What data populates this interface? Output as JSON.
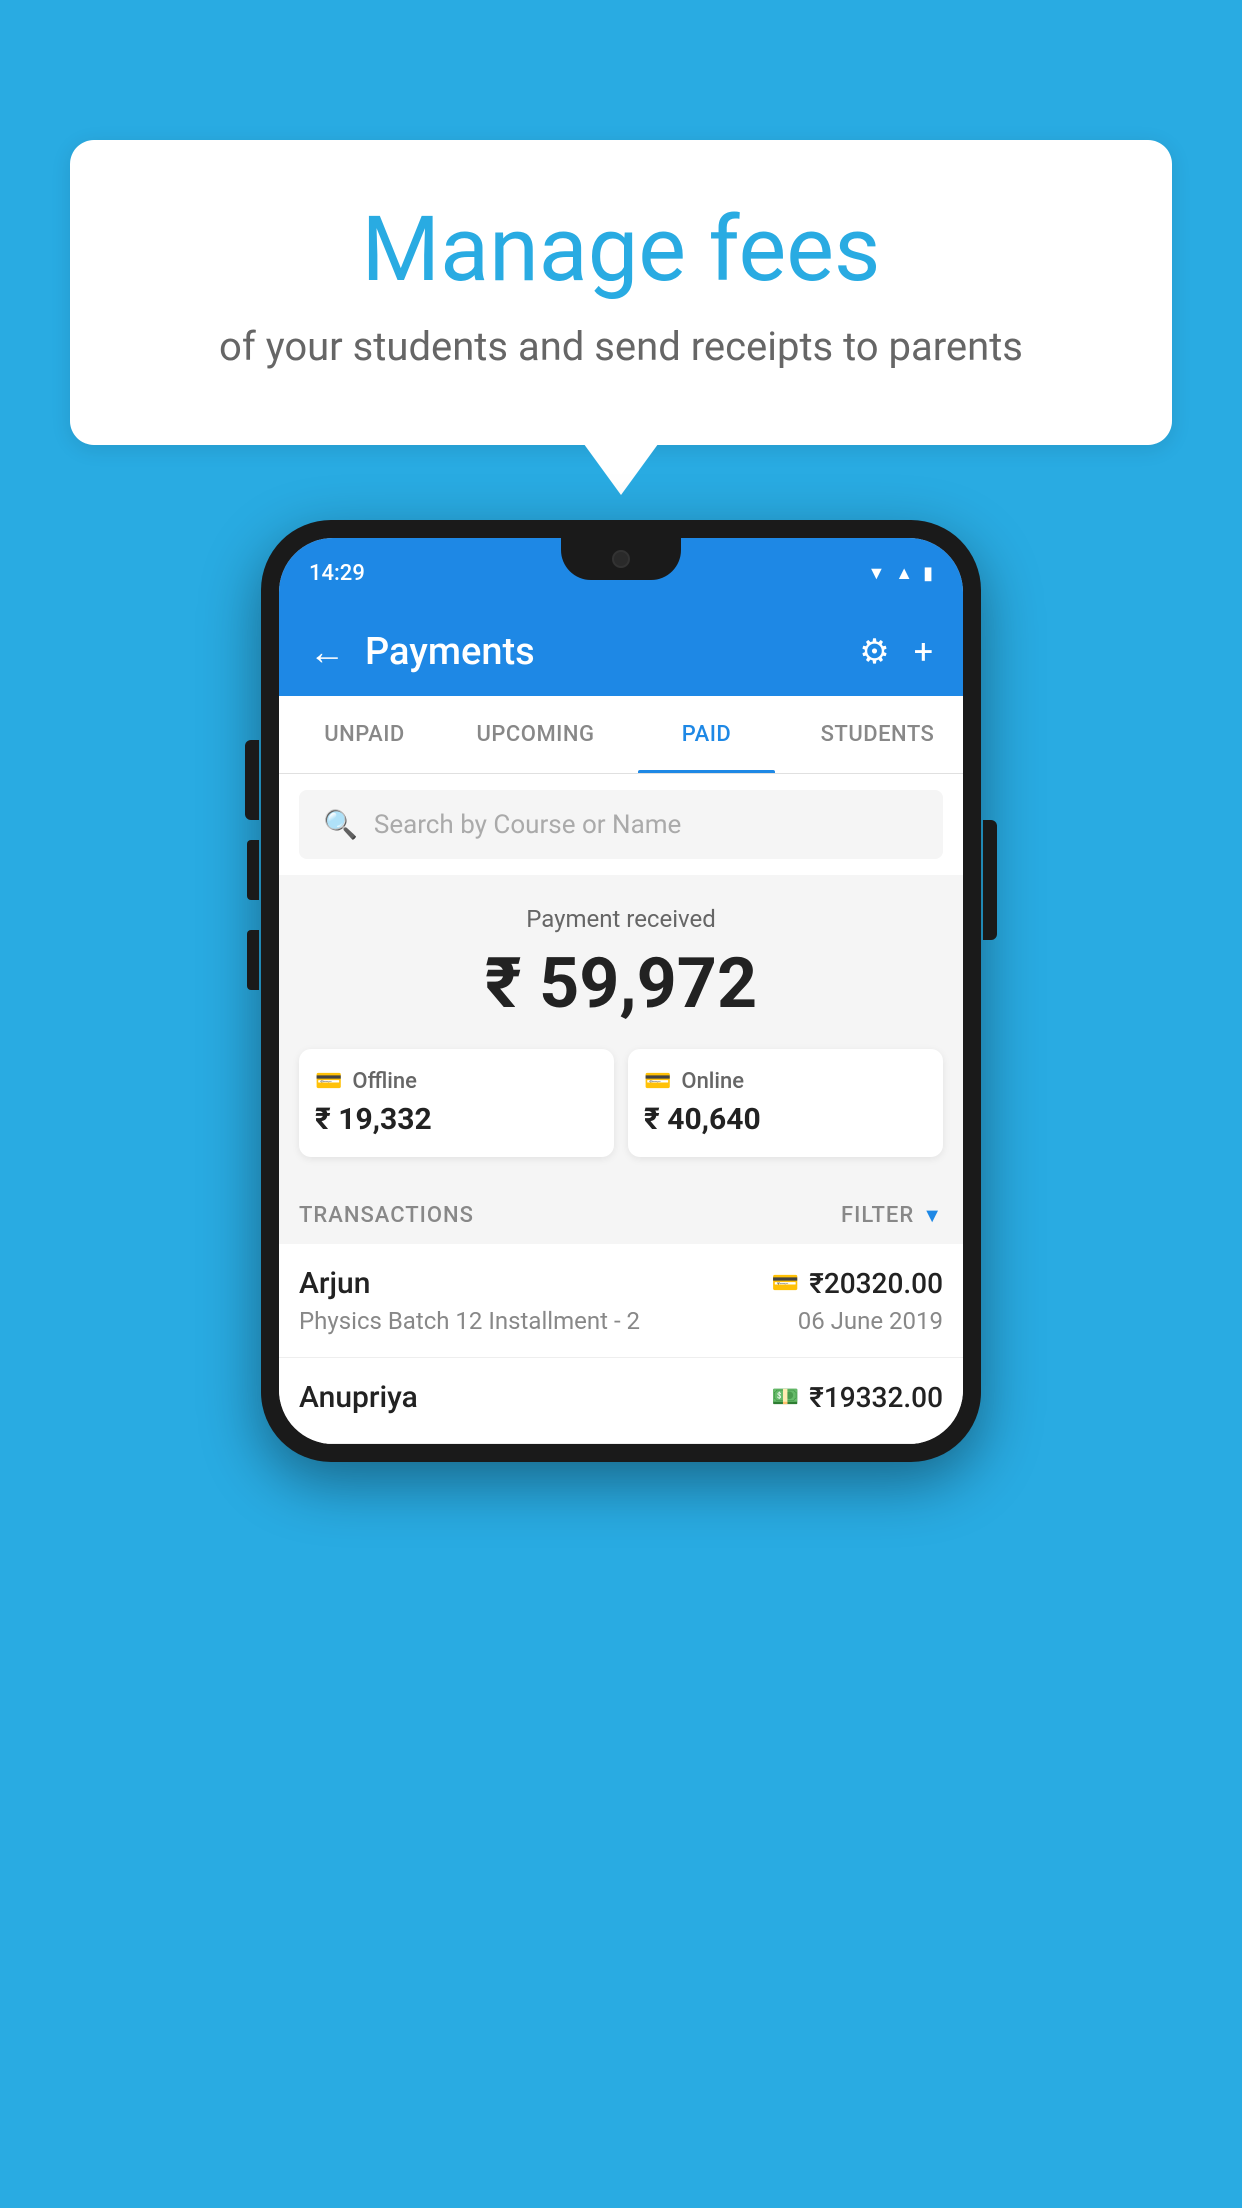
{
  "background_color": "#29ABE2",
  "bubble": {
    "title": "Manage fees",
    "subtitle": "of your students and send receipts to parents"
  },
  "phone": {
    "status_bar": {
      "time": "14:29"
    },
    "header": {
      "title": "Payments",
      "back_label": "←",
      "settings_label": "⚙",
      "add_label": "+"
    },
    "tabs": [
      {
        "label": "UNPAID",
        "active": false
      },
      {
        "label": "UPCOMING",
        "active": false
      },
      {
        "label": "PAID",
        "active": true
      },
      {
        "label": "STUDENTS",
        "active": false
      }
    ],
    "search": {
      "placeholder": "Search by Course or Name"
    },
    "payment_received": {
      "label": "Payment received",
      "total": "₹ 59,972",
      "offline": {
        "type": "Offline",
        "amount": "₹ 19,332"
      },
      "online": {
        "type": "Online",
        "amount": "₹ 40,640"
      }
    },
    "transactions": {
      "header_label": "TRANSACTIONS",
      "filter_label": "FILTER",
      "rows": [
        {
          "name": "Arjun",
          "course": "Physics Batch 12 Installment - 2",
          "amount": "₹20320.00",
          "date": "06 June 2019",
          "payment_type": "online"
        },
        {
          "name": "Anupriya",
          "course": "",
          "amount": "₹19332.00",
          "date": "",
          "payment_type": "offline"
        }
      ]
    }
  }
}
